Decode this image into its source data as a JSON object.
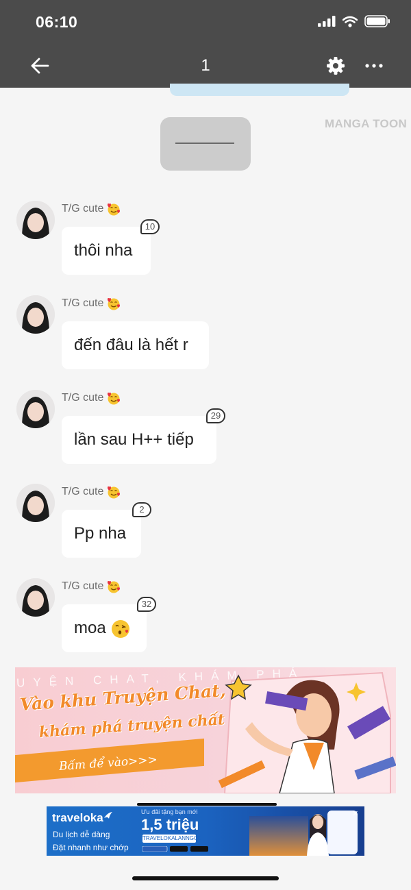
{
  "status_bar": {
    "time": "06:10"
  },
  "nav": {
    "title": "1"
  },
  "watermark": "MANGA TOON",
  "messages": [
    {
      "user": "T/G cute",
      "text": "thôi nha",
      "count": "10"
    },
    {
      "user": "T/G cute",
      "text": "đến đâu là hết r",
      "count": ""
    },
    {
      "user": "T/G cute",
      "text": "lần sau H++ tiếp",
      "count": "29"
    },
    {
      "user": "T/G cute",
      "text": "Pp nha",
      "count": "2"
    },
    {
      "user": "T/G cute",
      "text": "moa",
      "count": "32"
    }
  ],
  "banner_chat": {
    "line1": "Vào khu Truyện Chat,",
    "line2": "khám phá truyện chất",
    "button": "Bấm để vào>>>",
    "marquee": "UYỆN CHAT, KHÁM PHÁ"
  },
  "ad": {
    "brand": "traveloka",
    "line1": "Du lịch dễ dàng",
    "line2": "Đặt nhanh như chớp",
    "promo": "Ưu đãi tặng bạn mới",
    "amount": "1,5 triệu",
    "code": "TRAVELOKALANNGOC"
  },
  "icons": {
    "back": "arrow-left-icon",
    "settings": "gear-icon",
    "more": "more-horizontal-icon",
    "signal": "signal-icon",
    "wifi": "wifi-icon",
    "battery": "battery-icon",
    "love_emoji": "smiling-face-with-hearts-emoji",
    "kiss_emoji": "face-blowing-kiss-emoji"
  },
  "colors": {
    "bar": "#4b4b4b",
    "background": "#f5f5f5",
    "dash_bubble": "#cccccc",
    "banner_orange": "#f39a2e",
    "ad_blue": "#1b63c0"
  }
}
